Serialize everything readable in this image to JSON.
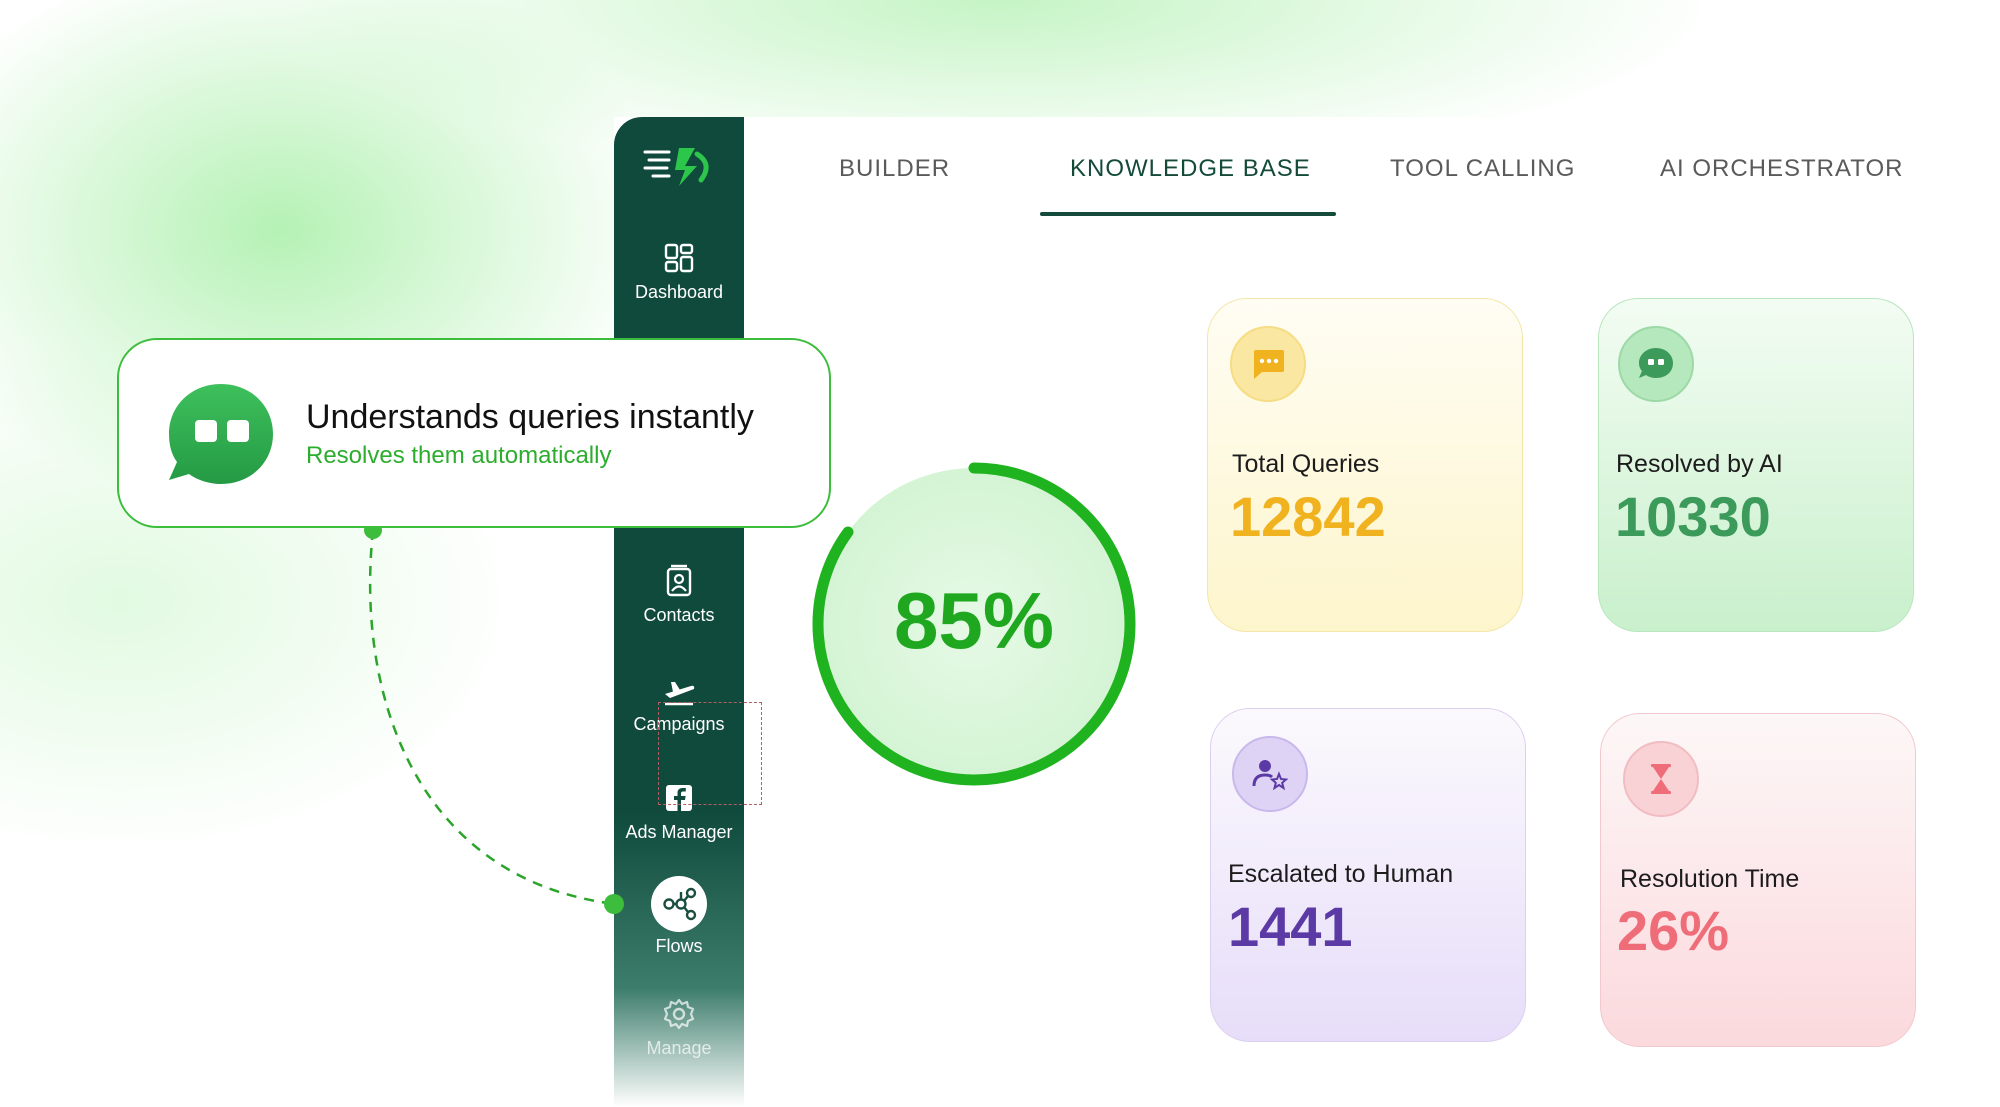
{
  "sidebar": {
    "items": [
      {
        "label": "Dashboard",
        "icon": "dashboard-icon"
      },
      {
        "label": "Contacts",
        "icon": "contacts-icon"
      },
      {
        "label": "Campaigns",
        "icon": "airplane-icon"
      },
      {
        "label": "Ads Manager",
        "icon": "facebook-icon"
      },
      {
        "label": "Flows",
        "icon": "flows-icon"
      },
      {
        "label": "Manage",
        "icon": "gear-icon"
      }
    ]
  },
  "tabs": [
    {
      "label": "BUILDER"
    },
    {
      "label": "KNOWLEDGE BASE",
      "active": true
    },
    {
      "label": "TOOL CALLING"
    },
    {
      "label": "AI ORCHESTRATOR"
    }
  ],
  "callout": {
    "title": "Understands queries instantly",
    "subtitle": "Resolves them automatically",
    "icon": "chat-bubble-icon"
  },
  "gauge": {
    "label": "85%",
    "percent": 85
  },
  "stats": [
    {
      "label": "Total Queries",
      "value": "12842",
      "icon": "message-icon",
      "color": "#f0b21e"
    },
    {
      "label": "Resolved by AI",
      "value": "10330",
      "icon": "chat-icon",
      "color": "#3c9a5a"
    },
    {
      "label": "Escalated to Human",
      "value": "1441",
      "icon": "user-star-icon",
      "color": "#5b3aa6"
    },
    {
      "label": "Resolution Time",
      "value": "26%",
      "icon": "hourglass-icon",
      "color": "#ef6d79"
    }
  ],
  "colors": {
    "sidebar": "#0f4a3c",
    "accent_green": "#1fa81f",
    "tab_active": "#134a3a"
  }
}
